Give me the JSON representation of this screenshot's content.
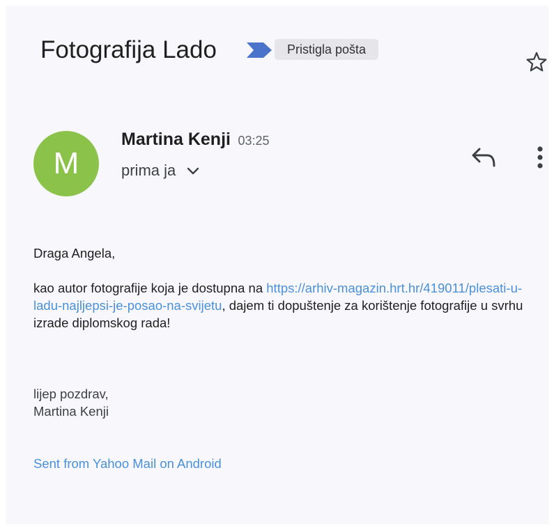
{
  "header": {
    "subject": "Fotografija Lado",
    "label": "Pristigla pošta",
    "icons": {
      "importance": "importance-marker-icon",
      "star": "star-icon"
    },
    "colors": {
      "importance_marker": "#4a74c9",
      "label_background": "#e6e6ea"
    }
  },
  "message": {
    "avatar_letter": "M",
    "avatar_color": "#8bc34a",
    "sender_name": "Martina Kenji",
    "time": "03:25",
    "recipient": "prima ja",
    "icons": {
      "expand": "chevron-down-icon",
      "reply": "reply-icon",
      "more": "more-vert-icon"
    }
  },
  "body": {
    "greeting": "Draga Angela,",
    "paragraph_before_link": "kao autor fotografije koja je dostupna na ",
    "link_text": "https://arhiv-magazin.hrt.hr/419011/plesati-u-ladu-najljepsi-je-posao-na-svijetu",
    "paragraph_after_link": ", dajem ti dopuštenje za korištenje fotografije u svrhu izrade diplomskog rada!",
    "closing": "lijep pozdrav,",
    "signature": "Martina Kenji",
    "footer_link": "Sent from Yahoo Mail on Android",
    "link_color": "#4a90d9"
  }
}
